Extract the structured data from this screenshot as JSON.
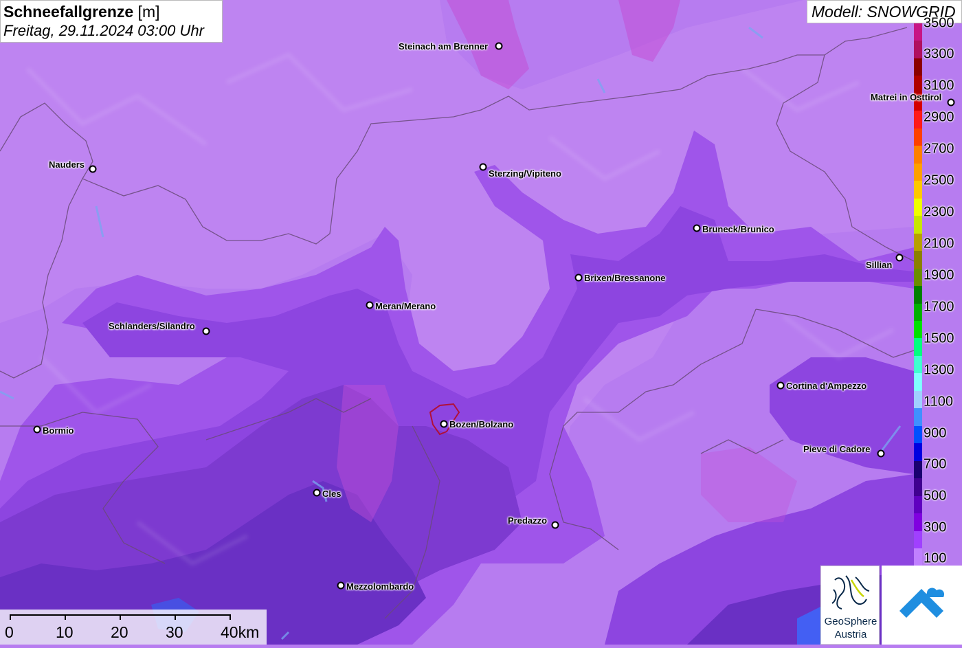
{
  "title": {
    "main": "Schneefallgrenze",
    "unit": "[m]",
    "datetime": "Freitag, 29.11.2024 03:00 Uhr"
  },
  "model": "Modell: SNOWGRID",
  "legend": {
    "labels": [
      "3500",
      "3300",
      "3100",
      "2900",
      "2700",
      "2500",
      "2300",
      "2100",
      "1900",
      "1700",
      "1500",
      "1300",
      "1100",
      "900",
      "700",
      "500",
      "300",
      "100"
    ],
    "colors": [
      "#c71585",
      "#b01060",
      "#8b0000",
      "#b00000",
      "#d40000",
      "#ff1a1a",
      "#ff4000",
      "#ff8000",
      "#ffa000",
      "#ffc800",
      "#f0ff00",
      "#c8e600",
      "#b8a000",
      "#8b8000",
      "#6b8e00",
      "#008000",
      "#00b000",
      "#00e000",
      "#00ff80",
      "#40ffd0",
      "#80ffff",
      "#a0d0ff",
      "#4090ff",
      "#0050ff",
      "#0000e0",
      "#1a0070",
      "#400090",
      "#6000c0",
      "#8000e0",
      "#a040ff",
      "#c080ff"
    ]
  },
  "cities": [
    {
      "name": "Steinach am Brenner"
    },
    {
      "name": "Matrei in Osttirol"
    },
    {
      "name": "Nauders"
    },
    {
      "name": "Sterzing/Vipiteno"
    },
    {
      "name": "Bruneck/Brunico"
    },
    {
      "name": "Sillian"
    },
    {
      "name": "Brixen/Bressanone"
    },
    {
      "name": "Meran/Merano"
    },
    {
      "name": "Schlanders/Silandro"
    },
    {
      "name": "Cortina d'Ampezzo"
    },
    {
      "name": "Bormio"
    },
    {
      "name": "Bozen/Bolzano"
    },
    {
      "name": "Pieve di Cadore"
    },
    {
      "name": "Cles"
    },
    {
      "name": "Predazzo"
    },
    {
      "name": "Mezzolombardo"
    }
  ],
  "scale": {
    "labels": [
      "0",
      "10",
      "20",
      "30",
      "40km"
    ]
  },
  "logos": {
    "geosphere_line1": "GeoSphere",
    "geosphere_line2": "Austria"
  },
  "colors": {
    "snowline_high": "#b77cf0",
    "snowline_mid": "#9f55ea",
    "snowline_low": "#7d3ad0",
    "snowline_lowest": "#5a2ab8",
    "border_line": "#6a4a7a"
  }
}
